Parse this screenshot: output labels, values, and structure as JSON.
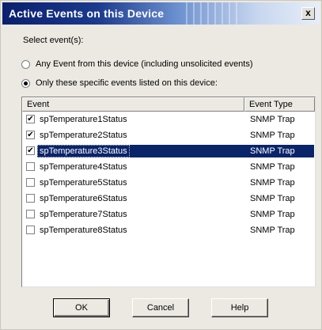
{
  "window": {
    "title": "Active Events on this Device",
    "close_label": "x"
  },
  "select_label": "Select event(s):",
  "options": [
    {
      "label": "Any Event from this device (including unsolicited events)",
      "selected": false
    },
    {
      "label": "Only these specific events listed on this device:",
      "selected": true
    }
  ],
  "table": {
    "columns": [
      "Event",
      "Event Type"
    ],
    "rows": [
      {
        "event": "spTemperature1Status",
        "type": "SNMP Trap",
        "checked": true,
        "selected": false
      },
      {
        "event": "spTemperature2Status",
        "type": "SNMP Trap",
        "checked": true,
        "selected": false
      },
      {
        "event": "spTemperature3Status",
        "type": "SNMP Trap",
        "checked": true,
        "selected": true
      },
      {
        "event": "spTemperature4Status",
        "type": "SNMP Trap",
        "checked": false,
        "selected": false
      },
      {
        "event": "spTemperature5Status",
        "type": "SNMP Trap",
        "checked": false,
        "selected": false
      },
      {
        "event": "spTemperature6Status",
        "type": "SNMP Trap",
        "checked": false,
        "selected": false
      },
      {
        "event": "spTemperature7Status",
        "type": "SNMP Trap",
        "checked": false,
        "selected": false
      },
      {
        "event": "spTemperature8Status",
        "type": "SNMP Trap",
        "checked": false,
        "selected": false
      }
    ]
  },
  "buttons": {
    "ok": "OK",
    "cancel": "Cancel",
    "help": "Help"
  },
  "colors": {
    "selection": "#0a246a",
    "title_start": "#0a1f6e",
    "face": "#ece9e2"
  }
}
